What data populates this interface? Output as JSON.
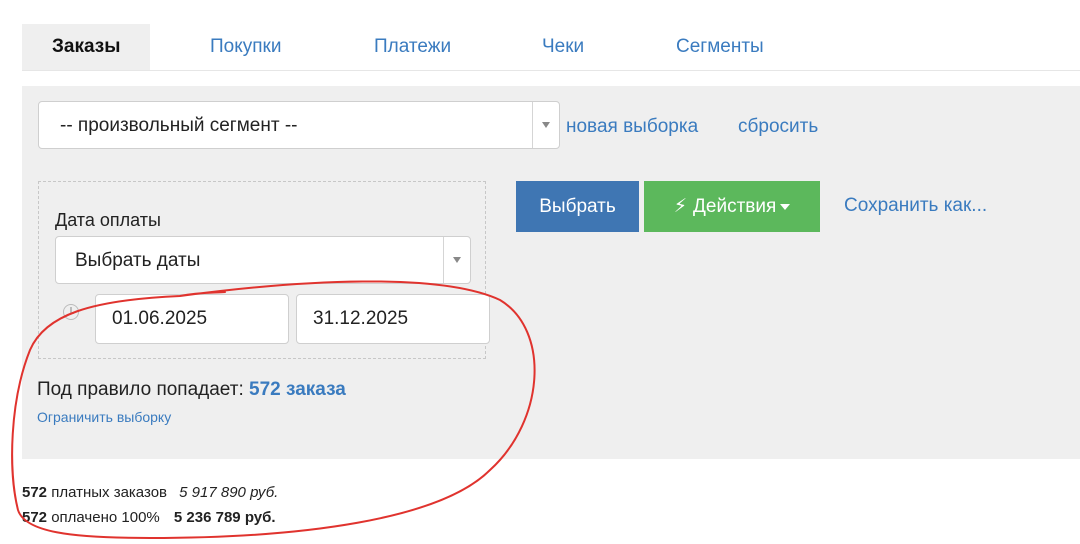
{
  "tabs": [
    {
      "label": "Заказы",
      "active": true
    },
    {
      "label": "Покупки",
      "active": false
    },
    {
      "label": "Платежи",
      "active": false
    },
    {
      "label": "Чеки",
      "active": false
    },
    {
      "label": "Сегменты",
      "active": false
    }
  ],
  "segment": {
    "selected": "-- произвольный сегмент --",
    "new_selection_label": "новая выборка",
    "reset_label": "сбросить"
  },
  "filter": {
    "label": "Дата оплаты",
    "date_mode": "Выбрать даты",
    "date_from": "01.06.2025",
    "date_to": "31.12.2025"
  },
  "actions": {
    "select_label": "Выбрать",
    "actions_label": "Действия",
    "save_as_label": "Сохранить как..."
  },
  "result": {
    "prefix": "Под правило попадает:",
    "count": "572 заказа",
    "limit_label": "Ограничить выборку"
  },
  "summary": {
    "row1": {
      "count": "572",
      "label": "платных заказов",
      "amount": "5 917 890 руб."
    },
    "row2": {
      "count": "572",
      "label": "оплачено 100%",
      "amount": "5 236 789 руб."
    }
  },
  "colors": {
    "link": "#3a7bbf",
    "primary_button": "#3f76b3",
    "success_button": "#5cb85c",
    "annotation": "#e0332e"
  }
}
